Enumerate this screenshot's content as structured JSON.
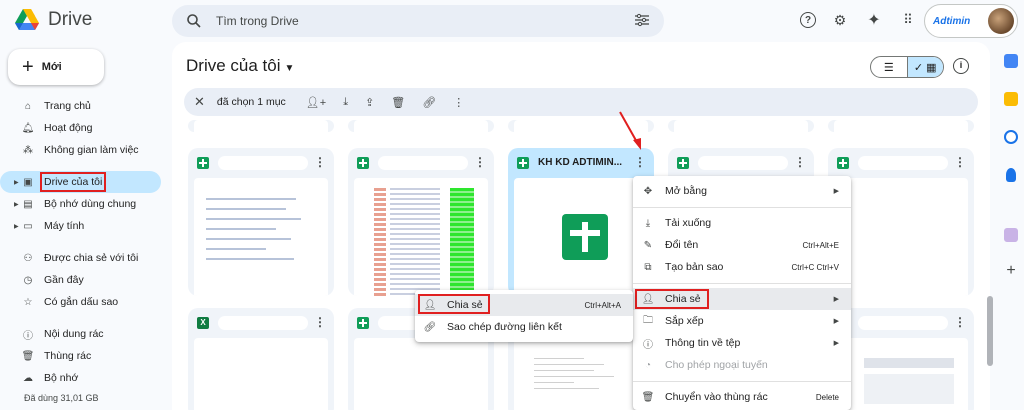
{
  "app": {
    "name": "Drive"
  },
  "search": {
    "placeholder": "Tìm trong Drive"
  },
  "account": {
    "brand": "Adtimin"
  },
  "sidebar": {
    "new_label": "Mới",
    "items": [
      {
        "label": "Trang chủ",
        "icon": "home-icon"
      },
      {
        "label": "Hoạt động",
        "icon": "bell-icon"
      },
      {
        "label": "Không gian làm việc",
        "icon": "workspace-icon"
      },
      {
        "label": "Drive của tôi",
        "icon": "drive-icon",
        "active": true
      },
      {
        "label": "Bộ nhớ dùng chung",
        "icon": "shared-drive-icon"
      },
      {
        "label": "Máy tính",
        "icon": "computer-icon"
      },
      {
        "label": "Được chia sẻ với tôi",
        "icon": "people-icon"
      },
      {
        "label": "Gần đây",
        "icon": "clock-icon"
      },
      {
        "label": "Có gắn dấu sao",
        "icon": "star-icon"
      },
      {
        "label": "Nội dung rác",
        "icon": "spam-icon"
      },
      {
        "label": "Thùng rác",
        "icon": "trash-icon"
      },
      {
        "label": "Bộ nhớ",
        "icon": "cloud-icon"
      }
    ],
    "storage_text": "Đã dùng 31,01 GB"
  },
  "main": {
    "title": "Drive của tôi",
    "selection_text": "đã chọn 1 mục",
    "selected_file_name": "KH KD ADTIMIN..."
  },
  "context_menu": {
    "items": [
      {
        "label": "Mở bằng",
        "icon": "open-with-icon",
        "submenu": true
      },
      {
        "label": "Tải xuống",
        "icon": "download-icon"
      },
      {
        "label": "Đổi tên",
        "icon": "rename-icon",
        "shortcut": "Ctrl+Alt+E"
      },
      {
        "label": "Tạo bản sao",
        "icon": "copy-icon",
        "shortcut": "Ctrl+C Ctrl+V"
      },
      {
        "label": "Chia sẻ",
        "icon": "share-icon",
        "submenu": true
      },
      {
        "label": "Sắp xếp",
        "icon": "folder-move-icon",
        "submenu": true
      },
      {
        "label": "Thông tin về tệp",
        "icon": "info-icon",
        "submenu": true
      },
      {
        "label": "Cho phép ngoại tuyến",
        "icon": "offline-icon",
        "disabled": true
      },
      {
        "label": "Chuyển vào thùng rác",
        "icon": "trash-icon",
        "shortcut": "Delete"
      }
    ]
  },
  "share_submenu": {
    "items": [
      {
        "label": "Chia sẻ",
        "icon": "share-icon",
        "shortcut": "Ctrl+Alt+A"
      },
      {
        "label": "Sao chép đường liên kết",
        "icon": "link-icon"
      }
    ]
  },
  "colors": {
    "accent": "#c2e7ff",
    "highlight_box": "#e02020",
    "sheets_green": "#0f9d58"
  }
}
